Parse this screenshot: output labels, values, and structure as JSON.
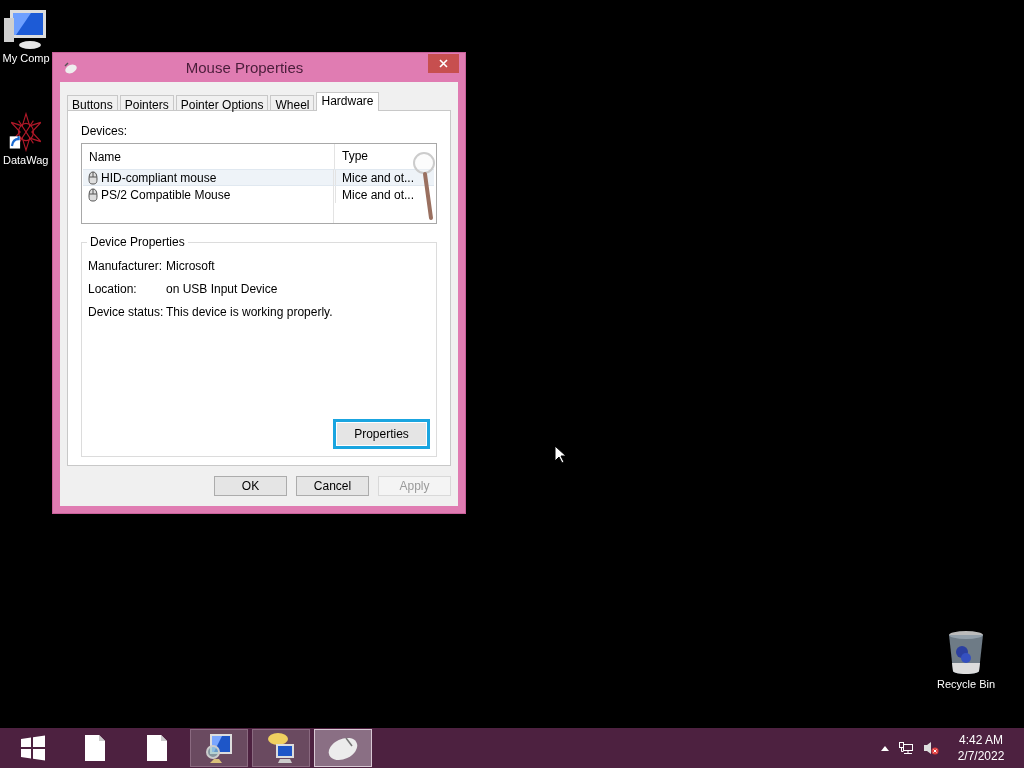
{
  "desktop_icons": [
    {
      "label": "My Comp",
      "kind": "computer"
    },
    {
      "label": "DataWag",
      "kind": "shortcut"
    },
    {
      "label": "Recycle Bin",
      "kind": "bin"
    }
  ],
  "window": {
    "title": "Mouse Properties",
    "tabs": [
      {
        "label": "Buttons",
        "selected": false
      },
      {
        "label": "Pointers",
        "selected": false
      },
      {
        "label": "Pointer Options",
        "selected": false
      },
      {
        "label": "Wheel",
        "selected": false
      },
      {
        "label": "Hardware",
        "selected": true
      }
    ],
    "devices_label": "Devices:",
    "devices": {
      "columns": [
        "Name",
        "Type"
      ],
      "rows": [
        {
          "name": "HID-compliant mouse",
          "type": "Mice and ot...",
          "selected": true
        },
        {
          "name": "PS/2 Compatible Mouse",
          "type": "Mice and ot...",
          "selected": false
        }
      ]
    },
    "device_properties": {
      "title": "Device Properties",
      "fields": [
        {
          "label": "Manufacturer:",
          "value": "Microsoft"
        },
        {
          "label": "Location:",
          "value": "on USB Input Device"
        },
        {
          "label": "Device status:",
          "value": "This device is working properly."
        }
      ],
      "button": {
        "label": "Properties",
        "focused": true
      }
    },
    "buttons": [
      {
        "label": "OK",
        "disabled": false
      },
      {
        "label": "Cancel",
        "disabled": false
      },
      {
        "label": "Apply",
        "disabled": true
      }
    ]
  },
  "taskbar": {
    "items": [
      {
        "kind": "start",
        "running": false,
        "active": false
      },
      {
        "kind": "file",
        "running": false,
        "active": false
      },
      {
        "kind": "file",
        "running": false,
        "active": false
      },
      {
        "kind": "computer-search",
        "running": true,
        "active": false
      },
      {
        "kind": "computer-chat",
        "running": true,
        "active": false
      },
      {
        "kind": "mouse",
        "running": true,
        "active": true
      }
    ],
    "clock": {
      "time": "4:42 AM",
      "date": "2/7/2022"
    }
  }
}
